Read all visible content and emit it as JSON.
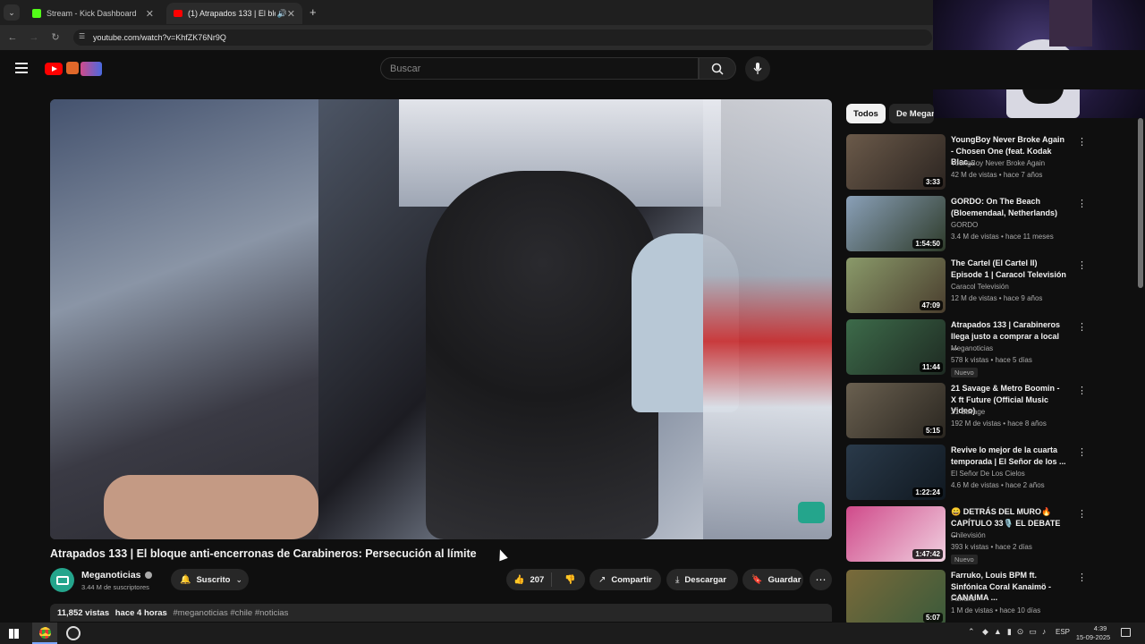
{
  "browser": {
    "tabs": [
      {
        "label": "Stream - Kick Dashboard",
        "active": false
      },
      {
        "label": "(1) Atrapados 133 | El bloq",
        "active": true
      }
    ],
    "url": "youtube.com/watch?v=KhfZK76Nr9Q"
  },
  "youtube": {
    "search_placeholder": "Buscar",
    "video": {
      "title": "Atrapados 133 | El bloque anti-encerronas de Carabineros: Persecución al límite",
      "channel": "Meganoticias",
      "subscribers": "3.44 M de suscriptores",
      "subscribe_label": "Suscrito",
      "likes": "207",
      "share": "Compartir",
      "download": "Descargar",
      "save": "Guardar",
      "views": "11,852 vistas",
      "age": "hace 4 horas",
      "tags": "#meganoticias #chile #noticias",
      "channel_logo": "meganoticias"
    },
    "chips": [
      "Todos",
      "De Megan"
    ],
    "recommendations": [
      {
        "title": "YoungBoy Never Broke Again - Chosen One (feat. Kodak Blac...",
        "channel": "YoungBoy Never Broke Again",
        "meta": "42 M de vistas • hace 7 años",
        "duration": "3:33",
        "badge": "",
        "colors": [
          "#6b5a4a",
          "#2b2420"
        ]
      },
      {
        "title": "GORDO: On The Beach (Bloemendaal, Netherlands)",
        "channel": "GORDO",
        "meta": "3.4 M de vistas • hace 11 meses",
        "duration": "1:54:50",
        "badge": "",
        "colors": [
          "#8aa0b8",
          "#2e3b2a"
        ]
      },
      {
        "title": "The Cartel (El Cartel II) Episode 1 | Caracol Televisión",
        "channel": "Caracol Televisión",
        "meta": "12 M de vistas • hace 9 años",
        "duration": "47:09",
        "badge": "",
        "colors": [
          "#8a9a6a",
          "#4a3e2e"
        ]
      },
      {
        "title": "Atrapados 133 | Carabineros llega justo a comprar a local ...",
        "channel": "Meganoticias",
        "meta": "578 k vistas • hace 5 días",
        "duration": "11:44",
        "badge": "Nuevo",
        "colors": [
          "#3d6b4a",
          "#1e2a22"
        ]
      },
      {
        "title": "21 Savage & Metro Boomin - X ft Future (Official Music Video)",
        "channel": "21 Savage",
        "meta": "192 M de vistas • hace 8 años",
        "duration": "5:15",
        "badge": "",
        "colors": [
          "#6a6050",
          "#2a2620"
        ]
      },
      {
        "title": "Revive lo mejor de la cuarta temporada | El Señor de los ...",
        "channel": "El Señor De Los Cielos",
        "meta": "4.6 M de vistas • hace 2 años",
        "duration": "1:22:24",
        "badge": "",
        "colors": [
          "#2a3a4a",
          "#101820"
        ]
      },
      {
        "title": "😄 DETRÁS DEL MURO🔥 CAPÍTULO 33🎙️ EL DEBATE ...",
        "channel": "Chilevisión",
        "meta": "393 k vistas • hace 2 días",
        "duration": "1:47:42",
        "badge": "Nuevo",
        "colors": [
          "#d04a8a",
          "#f0d0e0"
        ]
      },
      {
        "title": "Farruko, Louis BPM ft. Sinfónica Coral Kanaimö - CANAIMA ...",
        "channel": "Farruko",
        "meta": "1 M de vistas • hace 10 días",
        "duration": "5:07",
        "badge": "",
        "colors": [
          "#7a6a3a",
          "#3a5a3a"
        ]
      }
    ]
  },
  "taskbar": {
    "lang": "ESP",
    "time": "4:39",
    "date": "15-09-2025"
  },
  "colors": {
    "yt_red": "#ff0000",
    "bg": "#0f0f0f",
    "chip_active": "#f1f1f1"
  }
}
